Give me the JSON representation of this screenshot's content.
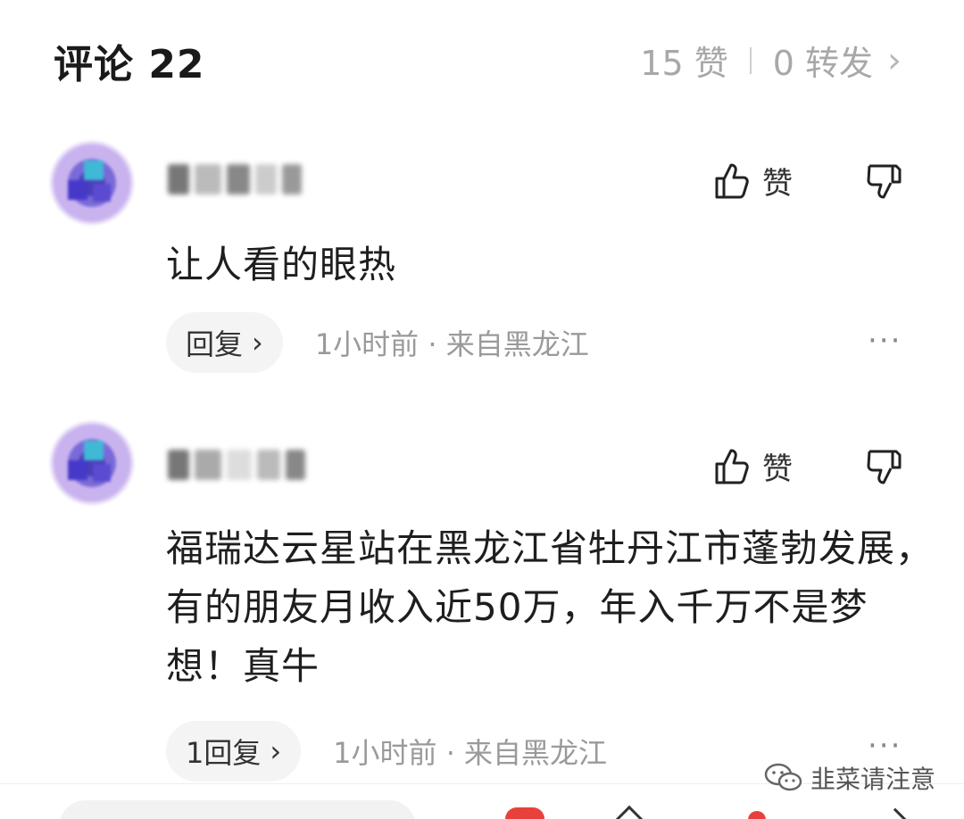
{
  "header": {
    "title": "评论 22",
    "likes": "15 赞",
    "shares": "0 转发",
    "chevron": "›"
  },
  "comments": [
    {
      "like_label": "赞",
      "text": "让人看的眼热",
      "reply_label": "回复",
      "reply_chevron": "›",
      "meta": "1小时前 · 来自黑龙江",
      "more": "···"
    },
    {
      "like_label": "赞",
      "text": "福瑞达云星站在黑龙江省牡丹江市蓬勃发展，有的朋友月收入近50万，年入千万不是梦想！真牛",
      "reply_label": "1回复",
      "reply_chevron": "›",
      "meta": "1小时前 · 来自黑龙江",
      "more": "···"
    }
  ],
  "watermark": {
    "text": "韭菜请注意"
  },
  "colors": {
    "accent_red": "#e8413c",
    "muted_gray": "#9a9a9a"
  },
  "icons": [
    "thumbs-up-icon",
    "thumbs-down-icon",
    "more-icon",
    "wechat-icon"
  ]
}
